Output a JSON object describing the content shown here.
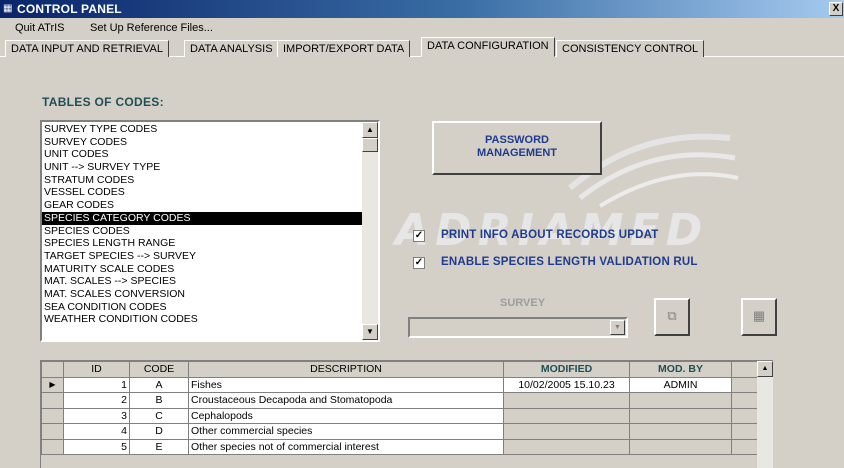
{
  "window": {
    "title": "CONTROL PANEL",
    "icon": "form-icon",
    "close_label": "X"
  },
  "menu": [
    "Quit ATrIS",
    "Set Up Reference Files..."
  ],
  "tabs": [
    {
      "label": "DATA INPUT AND RETRIEVAL",
      "active": false
    },
    {
      "label": "DATA ANALYSIS",
      "active": false
    },
    {
      "label": "IMPORT/EXPORT DATA",
      "active": false
    },
    {
      "label": "DATA CONFIGURATION",
      "active": true
    },
    {
      "label": "CONSISTENCY CONTROL",
      "active": false
    }
  ],
  "watermark": "ADRIAMED",
  "tables": {
    "title": "TABLES OF CODES:",
    "items": [
      "SURVEY TYPE CODES",
      "SURVEY CODES",
      "UNIT CODES",
      "UNIT --> SURVEY TYPE",
      "STRATUM CODES",
      "VESSEL CODES",
      "GEAR CODES",
      "SPECIES CATEGORY CODES",
      "SPECIES CODES",
      "SPECIES LENGTH RANGE",
      "TARGET SPECIES --> SURVEY",
      "MATURITY SCALE CODES",
      "MAT. SCALES --> SPECIES",
      "MAT. SCALES CONVERSION",
      "SEA CONDITION CODES",
      "WEATHER CONDITION CODES"
    ],
    "selected_index": 7
  },
  "password_button": {
    "line1": "PASSWORD",
    "line2": "MANAGEMENT"
  },
  "options": [
    {
      "label": "PRINT INFO ABOUT RECORDS UPDAT",
      "checked": true,
      "mark": "✓"
    },
    {
      "label": "ENABLE SPECIES LENGTH VALIDATION RUL",
      "checked": true,
      "mark": "✓"
    }
  ],
  "survey": {
    "label": "SURVEY",
    "value": ""
  },
  "grid": {
    "columns": [
      "ID",
      "CODE",
      "DESCRIPTION",
      "MODIFIED",
      "MOD. BY"
    ],
    "rows": [
      {
        "id": "1",
        "code": "A",
        "description": "Fishes",
        "modified": "10/02/2005 15.10.23",
        "mod_by": "ADMIN",
        "current": true
      },
      {
        "id": "2",
        "code": "B",
        "description": "Croustaceous Decapoda and Stomatopoda",
        "modified": "",
        "mod_by": "",
        "current": false
      },
      {
        "id": "3",
        "code": "C",
        "description": "Cephalopods",
        "modified": "",
        "mod_by": "",
        "current": false
      },
      {
        "id": "4",
        "code": "D",
        "description": "Other commercial species",
        "modified": "",
        "mod_by": "",
        "current": false
      },
      {
        "id": "5",
        "code": "E",
        "description": "Other species not of commercial interest",
        "modified": "",
        "mod_by": "",
        "current": false
      }
    ]
  },
  "colors": {
    "title_text": "#1f4f55",
    "button_text": "#1f3b8f",
    "face": "#d4d0c8"
  }
}
